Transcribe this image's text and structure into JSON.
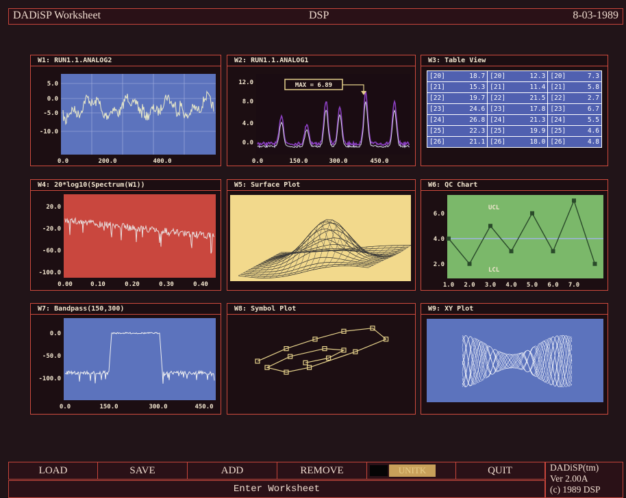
{
  "header": {
    "app_title": "DADiSP Worksheet",
    "center_title": "DSP",
    "date": "8-03-1989"
  },
  "windows": [
    {
      "id": "W1",
      "title": "W1: RUN1.1.ANALOG2",
      "y_ticks": [
        "5.0",
        "0.0",
        "-5.0",
        "-10.0"
      ],
      "x_ticks": [
        "0.0",
        "200.0",
        "400.0"
      ]
    },
    {
      "id": "W2",
      "title": "W2: RUN1.1.ANALOG1",
      "annotation": "MAX = 6.89",
      "y_ticks": [
        "12.0",
        "8.0",
        "4.0",
        "0.0"
      ],
      "x_ticks": [
        "0.0",
        "150.0",
        "300.0",
        "450.0"
      ]
    },
    {
      "id": "W3",
      "title": "W3: Table View"
    },
    {
      "id": "W4",
      "title": "W4: 20*log10(Spectrum(W1))",
      "y_ticks": [
        "20.0",
        "-20.0",
        "-60.0",
        "-100.0"
      ],
      "x_ticks": [
        "0.00",
        "0.10",
        "0.20",
        "0.30",
        "0.40"
      ]
    },
    {
      "id": "W5",
      "title": "W5: Surface Plot"
    },
    {
      "id": "W6",
      "title": "W6: QC Chart",
      "ucl": "UCL",
      "lcl": "LCL",
      "y_ticks": [
        "6.0",
        "4.0",
        "2.0"
      ],
      "x_ticks": [
        "1.0",
        "2.0",
        "3.0",
        "4.0",
        "5.0",
        "6.0",
        "7.0"
      ]
    },
    {
      "id": "W7",
      "title": "W7: Bandpass(150,300)",
      "y_ticks": [
        "0.0",
        "-50.0",
        "-100.0"
      ],
      "x_ticks": [
        "0.0",
        "150.0",
        "300.0",
        "450.0"
      ]
    },
    {
      "id": "W8",
      "title": "W8: Symbol Plot"
    },
    {
      "id": "W9",
      "title": "W9: XY Plot"
    }
  ],
  "table_view": {
    "rows": [
      [
        [
          "[20]",
          "18.7"
        ],
        [
          "[20]",
          "12.3"
        ],
        [
          "[20]",
          "7.3"
        ]
      ],
      [
        [
          "[21]",
          "15.3"
        ],
        [
          "[21]",
          "11.4"
        ],
        [
          "[21]",
          "5.8"
        ]
      ],
      [
        [
          "[22]",
          "19.7"
        ],
        [
          "[22]",
          "21.5"
        ],
        [
          "[22]",
          "2.7"
        ]
      ],
      [
        [
          "[23]",
          "24.6"
        ],
        [
          "[23]",
          "17.8"
        ],
        [
          "[23]",
          "6.7"
        ]
      ],
      [
        [
          "[24]",
          "26.8"
        ],
        [
          "[24]",
          "21.3"
        ],
        [
          "[24]",
          "5.5"
        ]
      ],
      [
        [
          "[25]",
          "22.3"
        ],
        [
          "[25]",
          "19.9"
        ],
        [
          "[25]",
          "4.6"
        ]
      ],
      [
        [
          "[26]",
          "21.1"
        ],
        [
          "[26]",
          "18.0"
        ],
        [
          "[26]",
          "4.8"
        ]
      ]
    ]
  },
  "menu": {
    "items": [
      "LOAD",
      "SAVE",
      "ADD",
      "REMOVE",
      "",
      "UNITK",
      "QUIT"
    ]
  },
  "status": {
    "prompt": "Enter Worksheet"
  },
  "version": {
    "line1": "DADiSP(tm)",
    "line2": "Ver 2.00A",
    "line3": "(c) 1989 DSP"
  },
  "colors": {
    "border": "#d04b3e",
    "blue_plot": "#5c73bd",
    "red_plot": "#c9473e",
    "yellow_plot": "#f2d98c",
    "green_plot": "#7bb86a",
    "trace": "#e6e6c8"
  },
  "qc_chart": {
    "x": [
      1,
      2,
      3,
      4,
      5,
      6,
      7,
      8
    ],
    "y": [
      4.0,
      2.0,
      5.0,
      3.0,
      6.0,
      3.0,
      7.0,
      2.0
    ]
  },
  "symbol_plot": {
    "points": [
      [
        0.5,
        2.0
      ],
      [
        2.0,
        2.8
      ],
      [
        3.5,
        3.4
      ],
      [
        5.0,
        3.9
      ],
      [
        6.5,
        4.1
      ],
      [
        7.2,
        3.4
      ],
      [
        5.6,
        2.6
      ],
      [
        3.2,
        1.6
      ],
      [
        2.0,
        1.3
      ],
      [
        1.0,
        1.6
      ],
      [
        2.2,
        2.3
      ],
      [
        4.0,
        2.8
      ],
      [
        5.0,
        2.7
      ],
      [
        4.2,
        2.2
      ],
      [
        3.0,
        1.9
      ]
    ]
  }
}
